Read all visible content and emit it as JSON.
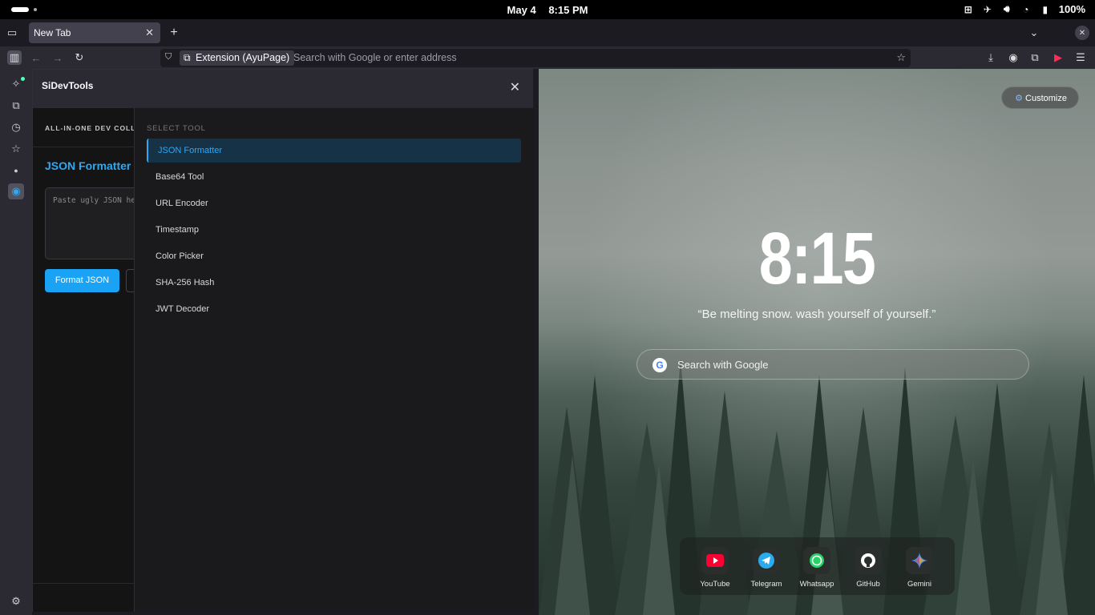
{
  "system": {
    "date": "May 4",
    "time": "8:15 PM",
    "battery": "100%"
  },
  "browser": {
    "tab_title": "New Tab",
    "url_chip": "Extension (AyuPage)",
    "url_placeholder": "Search with Google or enter address"
  },
  "sidebar_panel": {
    "title": "SiDevTools",
    "subtitle": "ALL-IN-ONE DEV COLLECTION",
    "tool_title": "JSON Formatter",
    "textarea_placeholder": "Paste ugly JSON here...",
    "format_button": "Format JSON",
    "select_label": "SELECT TOOL",
    "tools": [
      "JSON Formatter",
      "Base64 Tool",
      "URL Encoder",
      "Timestamp",
      "Color Picker",
      "SHA-256 Hash",
      "JWT Decoder"
    ],
    "selected_tool": "JSON Formatter"
  },
  "newtab": {
    "customize": "Customize",
    "clock": "8:15",
    "quote": "“Be melting snow. wash yourself of yourself.”",
    "search_placeholder": "Search with Google",
    "shortcuts": [
      {
        "name": "YouTube",
        "color": "#ff0033"
      },
      {
        "name": "Telegram",
        "color": "#2aabee"
      },
      {
        "name": "Whatsapp",
        "color": "#25d366"
      },
      {
        "name": "GitHub",
        "color": "#ffffff"
      },
      {
        "name": "Gemini",
        "color": "#8ab4f8"
      }
    ]
  },
  "colors": {
    "accent": "#2ea8f5",
    "button": "#1aa3f5"
  }
}
